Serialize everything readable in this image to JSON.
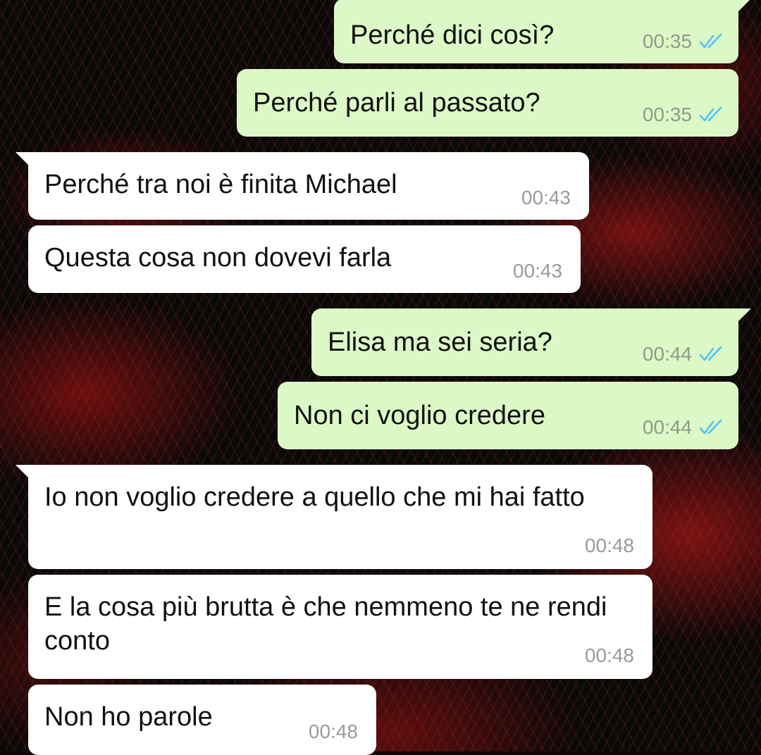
{
  "chat": {
    "messages": [
      {
        "direction": "outgoing",
        "text": "Perché dici così?",
        "time": "00:35",
        "status_icon": "double-check-read-icon"
      },
      {
        "direction": "outgoing",
        "text": "Perché parli al passato?",
        "time": "00:35",
        "status_icon": "double-check-read-icon"
      },
      {
        "direction": "incoming",
        "text": "Perché tra noi è finita Michael",
        "time": "00:43"
      },
      {
        "direction": "incoming",
        "text": "Questa cosa non dovevi farla",
        "time": "00:43"
      },
      {
        "direction": "outgoing",
        "text": "Elisa ma sei seria?",
        "time": "00:44",
        "status_icon": "double-check-read-icon"
      },
      {
        "direction": "outgoing",
        "text": "Non ci voglio credere",
        "time": "00:44",
        "status_icon": "double-check-read-icon"
      },
      {
        "direction": "incoming",
        "text": "Io non voglio credere a quello che mi hai fatto",
        "time": "00:48"
      },
      {
        "direction": "incoming",
        "text": "E la cosa più brutta è che nemmeno te ne rendi conto",
        "time": "00:48"
      },
      {
        "direction": "incoming",
        "text": "Non ho parole",
        "time": "00:48"
      }
    ]
  },
  "colors": {
    "outgoing_bubble": "#dcf8c6",
    "incoming_bubble": "#ffffff",
    "read_ticks": "#4fc3f7",
    "wallpaper_base": "#0c0808",
    "wallpaper_accent": "#c81a1a"
  }
}
